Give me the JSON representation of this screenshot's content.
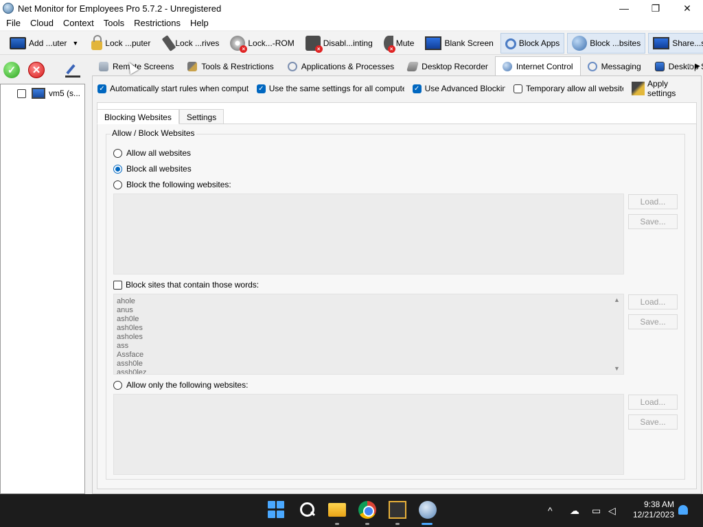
{
  "window": {
    "title": "Net Monitor for Employees Pro 5.7.2 - Unregistered",
    "minimize": "—",
    "maximize": "❐",
    "close": "✕"
  },
  "menu": [
    "File",
    "Cloud",
    "Context",
    "Tools",
    "Restrictions",
    "Help"
  ],
  "toolbar": {
    "add_computer": "Add ...uter",
    "lock_computer": "Lock ...puter",
    "lock_drives": "Lock ...rives",
    "lock_cdrom": "Lock...-ROM",
    "disable_printing": "Disabl...inting",
    "mute": "Mute",
    "blank_screen": "Blank Screen",
    "block_apps": "Block Apps",
    "block_websites": "Block ...bsites",
    "share_desktop": "Share...sktop"
  },
  "tree": {
    "computer_label": "vm5 (s..."
  },
  "tabs": [
    "Remote Screens",
    "Tools & Restrictions",
    "Applications & Processes",
    "Desktop Recorder",
    "Internet Control",
    "Messaging",
    "Desktop Shar"
  ],
  "options": {
    "auto_start": "Automatically start rules when computer is star",
    "same_settings": "Use the same settings for all computers",
    "advanced_blocking": "Use Advanced Blocking",
    "temp_allow": "Temporary allow all websites",
    "apply": "Apply settings"
  },
  "subtabs": [
    "Blocking Websites",
    "Settings"
  ],
  "group": {
    "title": "Allow / Block Websites",
    "allow_all": "Allow all websites",
    "block_all": "Block all websites",
    "block_following": "Block the following websites:",
    "block_words": "Block sites that contain those words:",
    "allow_only": "Allow only the following websites:",
    "selected": "block_all"
  },
  "buttons": {
    "load": "Load...",
    "save": "Save..."
  },
  "words": [
    "ahole",
    "anus",
    "ash0le",
    "ash0les",
    "asholes",
    "ass",
    "Assface",
    "assh0le",
    "assh0lez"
  ],
  "taskbar": {
    "time": "9:38 AM",
    "date": "12/21/2023"
  },
  "colors": {
    "accent": "#0067c0",
    "taskbar": "#1c1c1c"
  }
}
